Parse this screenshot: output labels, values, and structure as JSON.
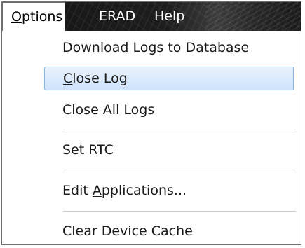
{
  "menubar": {
    "items": [
      {
        "label": "Options",
        "mnemonic_prefix": "O",
        "mnemonic_rest": "ptions",
        "state": "open"
      },
      {
        "label": "ERAD",
        "mnemonic_prefix": "E",
        "mnemonic_rest": "RAD"
      },
      {
        "label": "Help",
        "mnemonic_prefix": "H",
        "mnemonic_rest": "elp"
      }
    ]
  },
  "dropdown": {
    "items": [
      {
        "label": "Download Logs to Database",
        "pre": "Download Logs to Database",
        "key": "",
        "post": ""
      },
      {
        "label": "Close Log",
        "pre": "",
        "key": "C",
        "post": "lose Log",
        "highlighted": true
      },
      {
        "label": "Close All Logs",
        "pre": "Close All ",
        "key": "L",
        "post": "ogs"
      },
      {
        "label": "Set RTC",
        "pre": "Set ",
        "key": "R",
        "post": "TC"
      },
      {
        "label": "Edit Applications...",
        "pre": "Edit ",
        "key": "A",
        "post": "pplications..."
      },
      {
        "label": "Clear Device Cache",
        "pre": "Clear Device Cache",
        "key": "",
        "post": ""
      }
    ]
  },
  "colors": {
    "menubar_bg": "#1d1d1d",
    "highlight_bg": "#cfe3fb",
    "highlight_border": "#86b3e8"
  }
}
